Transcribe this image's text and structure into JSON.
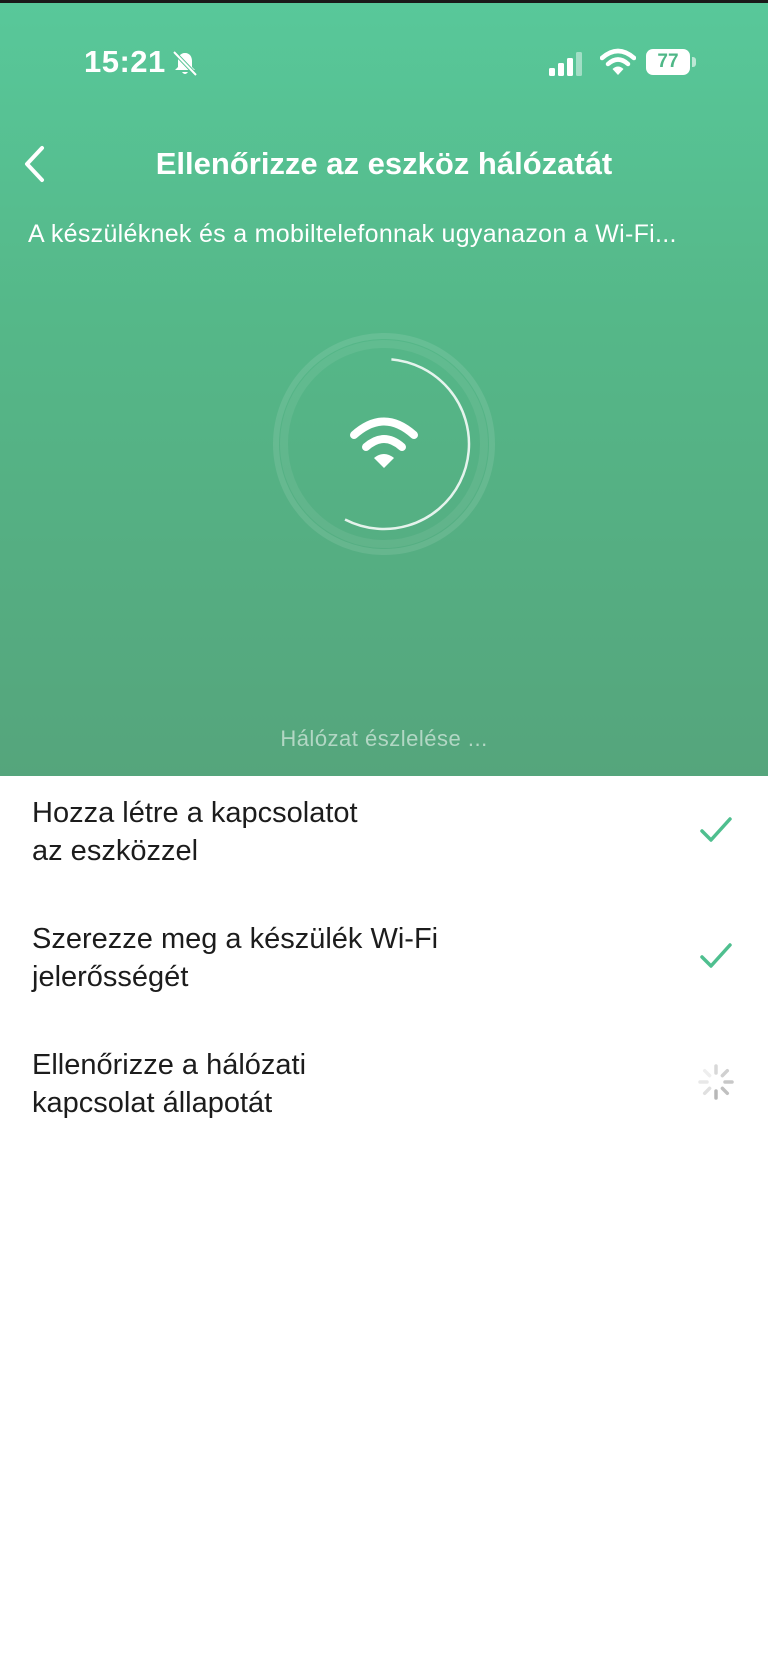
{
  "status_bar": {
    "time": "15:21",
    "battery": "77",
    "icons": [
      "bell-muted-icon",
      "signal-icon",
      "wifi-icon",
      "battery-icon"
    ]
  },
  "header": {
    "title": "Ellenőrizze az eszköz hálózatát",
    "subtitle": "A készüléknek és a mobiltelefonnak ugyanazon a Wi-Fi...",
    "back_icon": "chevron-left-icon"
  },
  "scanner": {
    "icon": "wifi-icon",
    "status_text": "Hálózat észlelése ..."
  },
  "steps": [
    {
      "line1": "Hozza létre a kapcsolatot",
      "line2": "az eszközzel",
      "state": "done",
      "icon": "check-icon"
    },
    {
      "line1": "Szerezze meg a készülék Wi-Fi",
      "line2": "jelerősségét",
      "state": "done",
      "icon": "check-icon"
    },
    {
      "line1": "Ellenőrizze a hálózati",
      "line2": "kapcsolat állapotát",
      "state": "loading",
      "icon": "spinner-icon"
    }
  ],
  "colors": {
    "accent": "#55b889",
    "check": "#4fbf8f",
    "text": "#1c1c1c"
  }
}
